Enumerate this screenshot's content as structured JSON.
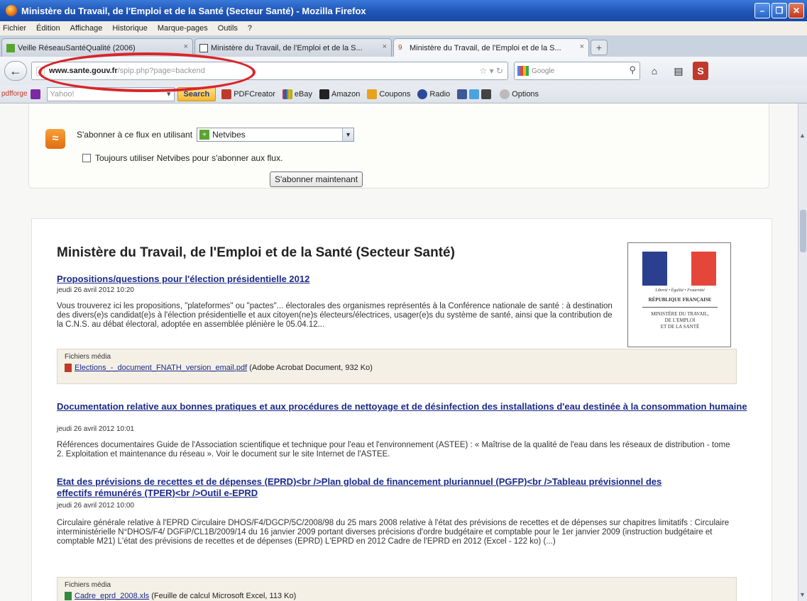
{
  "window": {
    "title": "Ministère du Travail, de l'Emploi et de la Santé (Secteur Santé) - Mozilla Firefox"
  },
  "menu": [
    "Fichier",
    "Édition",
    "Affichage",
    "Historique",
    "Marque-pages",
    "Outils",
    "?"
  ],
  "tabs": [
    {
      "label": "Veille RéseauSantéQualité (2006)",
      "active": false
    },
    {
      "label": "Ministère du Travail, de l'Emploi et de la S...",
      "active": false
    },
    {
      "label": "Ministère du Travail, de l'Emploi et de la S...",
      "active": true
    }
  ],
  "nav": {
    "url_host": "www.sante.gouv.fr",
    "url_path": "/spip.php?page=backend",
    "search_placeholder": "Google"
  },
  "toolbar": {
    "pdfforge": "pdfforge",
    "yahoo_placeholder": "Yahoo!",
    "search_button": "Search",
    "items": [
      "PDFCreator",
      "eBay",
      "Amazon",
      "Coupons",
      "Radio",
      "Options"
    ]
  },
  "subscribe": {
    "label": "S'abonner à ce flux en utilisant",
    "selected": "Netvibes",
    "always_label": "Toujours utiliser Netvibes pour s'abonner aux flux.",
    "button": "S'abonner maintenant"
  },
  "feed": {
    "title": "Ministère du Travail, de l'Emploi et de la Santé (Secteur Santé)",
    "logo": {
      "motto": "Liberté • Égalité • Fraternité",
      "republic": "RÉPUBLIQUE FRANÇAISE",
      "ministry": "MINISTÈRE DU TRAVAIL,\nDE L'EMPLOI\nET DE LA SANTÉ"
    },
    "articles": [
      {
        "title": "Propositions/questions pour l'élection présidentielle 2012",
        "date": "jeudi 26 avril 2012 10:20",
        "body": "Vous trouverez ici les propositions, \"plateformes\" ou \"pactes\"... électorales des organismes représentés à la Conférence nationale de santé : à destination des divers(e)s candidat(e)s à l'élection présidentielle et aux citoyen(ne)s électeurs/électrices, usager(e)s du système de santé, ainsi que la contribution de la C.N.S. au débat électoral, adoptée en assemblée plénière le 05.04.12...",
        "media_label": "Fichiers média",
        "media_file": "Elections_-_document_FNATH_version_email.pdf",
        "media_info": "(Adobe Acrobat Document, 932 Ko)"
      },
      {
        "title": "Documentation relative aux bonnes pratiques et aux procédures de nettoyage et de désinfection des installations d'eau destinée à la consommation humaine",
        "date": "jeudi 26 avril 2012 10:01",
        "body": "Références documentaires Guide de l'Association scientifique et technique pour l'eau et l'environnement (ASTEE) : « Maîtrise de la qualité de l'eau dans les réseaux de distribution - tome 2. Exploitation et maintenance du réseau ». Voir le document sur le site Internet de l'ASTEE."
      },
      {
        "title": "Etat des prévisions de recettes et de dépenses (EPRD)<br />Plan global de financement pluriannuel (PGFP)<br />Tableau prévisionnel des effectifs rémunérés (TPER)<br />Outil e-EPRD",
        "date": "jeudi 26 avril 2012 10:00",
        "body": "Circulaire générale relative à l'EPRD Circulaire DHOS/F4/DGCP/5C/2008/98 du 25 mars 2008 relative à l'état des prévisions de recettes et de dépenses sur chapitres limitatifs : Circulaire interministérielle N°DHOS/F4/ DGFiP/CL1B/2009/14 du 16 janvier 2009 portant diverses précisions d'ordre budgétaire et comptable pour le 1er janvier 2009 (instruction budgétaire et comptable M21) L'état des prévisions de recettes et de dépenses (EPRD) L'EPRD en 2012 Cadre de l'EPRD en 2012 (Excel - 122 ko) (...)",
        "media_label": "Fichiers média",
        "media_file": "Cadre_eprd_2008.xls",
        "media_info": "(Feuille de calcul Microsoft Excel, 113 Ko)"
      }
    ]
  },
  "colors": {
    "link": "#1a2a8a",
    "annotation_oval": "#d8262b",
    "titlebar": "#1f56b8"
  }
}
